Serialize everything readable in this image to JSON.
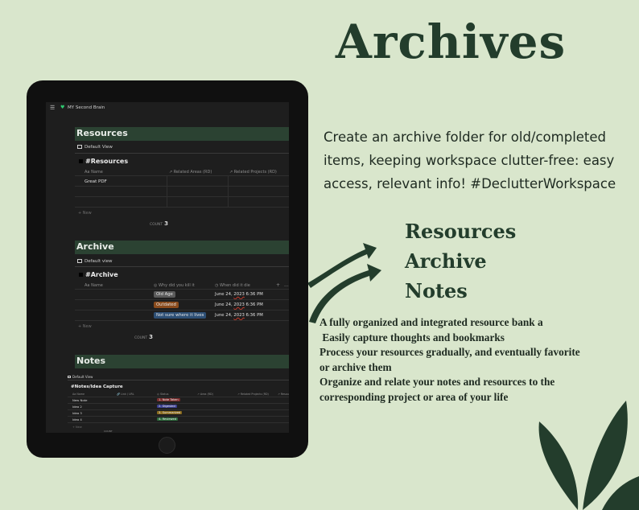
{
  "headline": "Archives",
  "tagline": "Create an archive folder for old/completed items, keeping workspace clutter-free: easy access, relevant info! #DeclutterWorkspace",
  "features": [
    "Resources",
    "Archive",
    "Notes"
  ],
  "description_lines": [
    "A fully organized and integrated resource bank a",
    " Easily capture thoughts and bookmarks",
    "Process your resources gradually, and eventually favorite",
    "or archive them",
    "Organize and relate your notes and resources to the",
    "corresponding project or area of your life"
  ],
  "colors": {
    "background": "#d9e6cc",
    "brand_green": "#233d2c",
    "section_bar": "#2b4232",
    "favorite_heart": "#2ecc71"
  },
  "app": {
    "workspace": "MY Second Brain",
    "menu_icon": "hamburger-icon",
    "heart_icon": "green-heart-icon"
  },
  "resources": {
    "section_title": "Resources",
    "view_tab": "Default View",
    "db_title": "#Resources",
    "columns": [
      "Name",
      "Related Areas (RD)",
      "Related Projects (RD)"
    ],
    "col_prefix": "Aa",
    "rows": [
      {
        "name": "Great PDF"
      }
    ],
    "new_label": "+ New",
    "count_label": "COUNT",
    "count_value": "3"
  },
  "archive": {
    "section_title": "Archive",
    "view_tab": "Default view",
    "db_title": "#Archive",
    "columns": [
      "Name",
      "Why did you kill it",
      "When did it die",
      "+",
      "..."
    ],
    "col_prefix": "Aa",
    "rows": [
      {
        "reason": "Old Age",
        "reason_color": "#5a5a5a",
        "date_pre": "June 24, ",
        "year": "2023",
        "time": " 6:36 PM"
      },
      {
        "reason": "Outdated",
        "reason_color": "#8a4b1c",
        "date_pre": "June 24, ",
        "year": "2023",
        "time": " 6:36 PM"
      },
      {
        "reason": "Not sure where it lives",
        "reason_color": "#2d4f75",
        "date_pre": "June 24, ",
        "year": "2023",
        "time": " 6:36 PM"
      }
    ],
    "new_label": "+ New",
    "count_label": "COUNT",
    "count_value": "3"
  },
  "notes": {
    "section_title": "Notes",
    "view_tab": "Default View",
    "db_title": "#Notes/Idea Capture",
    "columns": [
      "Name",
      "Link / URL",
      "Status",
      "Area (RD)",
      "Related Projects (RD)",
      "Resou"
    ],
    "rows": [
      {
        "name": "New Note",
        "status": "1- Note Taken",
        "status_color": "#7a2d2d"
      },
      {
        "name": "Idea 2",
        "status": "2- Digested",
        "status_color": "#3b3f8f"
      },
      {
        "name": "Idea 3",
        "status": "3- Summarized",
        "status_color": "#8a6a1c"
      },
      {
        "name": "Idea 4",
        "status": "4- Reviewed",
        "status_color": "#2d6b3c"
      }
    ],
    "new_label": "+ New",
    "count_label": "COUNT"
  }
}
